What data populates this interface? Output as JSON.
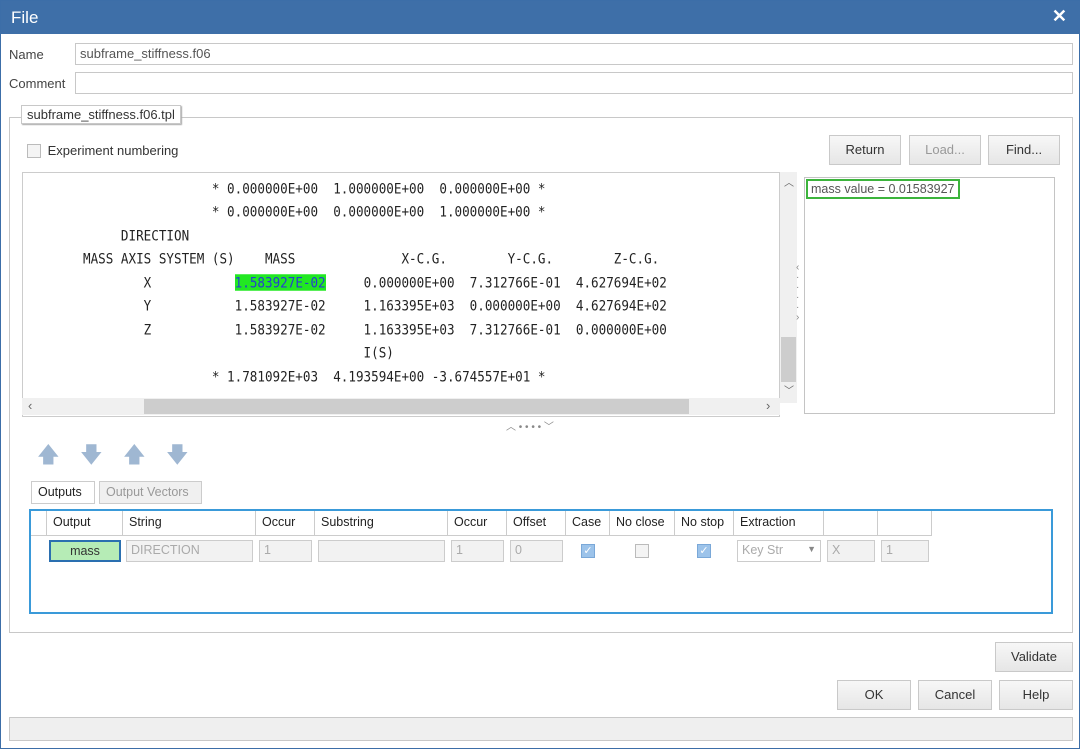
{
  "window": {
    "title": "File",
    "close_icon": "close-icon"
  },
  "form": {
    "name_label": "Name",
    "name_value": "subframe_stiffness.f06",
    "comment_label": "Comment",
    "comment_value": ""
  },
  "group": {
    "tab_label": "subframe_stiffness.f06.tpl",
    "experiment_numbering": "Experiment numbering",
    "experiment_checked": false
  },
  "buttons": {
    "return": "Return",
    "load": "Load...",
    "find": "Find...",
    "validate": "Validate",
    "ok": "OK",
    "cancel": "Cancel",
    "help": "Help"
  },
  "file_view": {
    "lines": [
      "                 * 0.000000E+00  1.000000E+00  0.000000E+00 *",
      "                 * 0.000000E+00  0.000000E+00  1.000000E+00 *",
      "     DIRECTION",
      "MASS AXIS SYSTEM (S)    MASS              X-C.G.        Y-C.G.        Z-C.G.",
      "",
      "        Y           1.583927E-02     1.163395E+03  0.000000E+00  4.627694E+02",
      "        Z           1.583927E-02     1.163395E+03  7.312766E-01  0.000000E+00",
      "                                     I(S)",
      "                 * 1.781092E+03  4.193594E+00 -3.674557E+01 *"
    ],
    "highlight_row": {
      "prefix": "        X           ",
      "highlight": "1.583927E-02",
      "suffix": "     0.000000E+00  7.312766E-01  4.627694E+02"
    },
    "highlight_color": "#22e822"
  },
  "result_panel": {
    "text": "mass value = 0.01583927",
    "border_color": "#3cb43c"
  },
  "arrows": [
    "arrow-up-icon",
    "arrow-down-icon",
    "arrow-up-top-icon",
    "arrow-down-bottom-icon"
  ],
  "tabs": [
    "Outputs",
    "Output Vectors"
  ],
  "table": {
    "headers": [
      "Output",
      "String",
      "Occur",
      "Substring",
      "Occur",
      "Offset",
      "Case",
      "No close",
      "No stop",
      "Extraction",
      "",
      ""
    ],
    "row": {
      "output": "mass",
      "string": "DIRECTION",
      "occur": "1",
      "substring": "",
      "occur2": "1",
      "offset": "0",
      "case": true,
      "no_close": false,
      "no_stop": true,
      "extraction": "Key Str",
      "col11": "X",
      "col12": "1"
    }
  },
  "colors": {
    "titlebar": "#3e6fa8",
    "selection_border": "#3a9ad9",
    "output_cell": "#b6ecb6"
  }
}
